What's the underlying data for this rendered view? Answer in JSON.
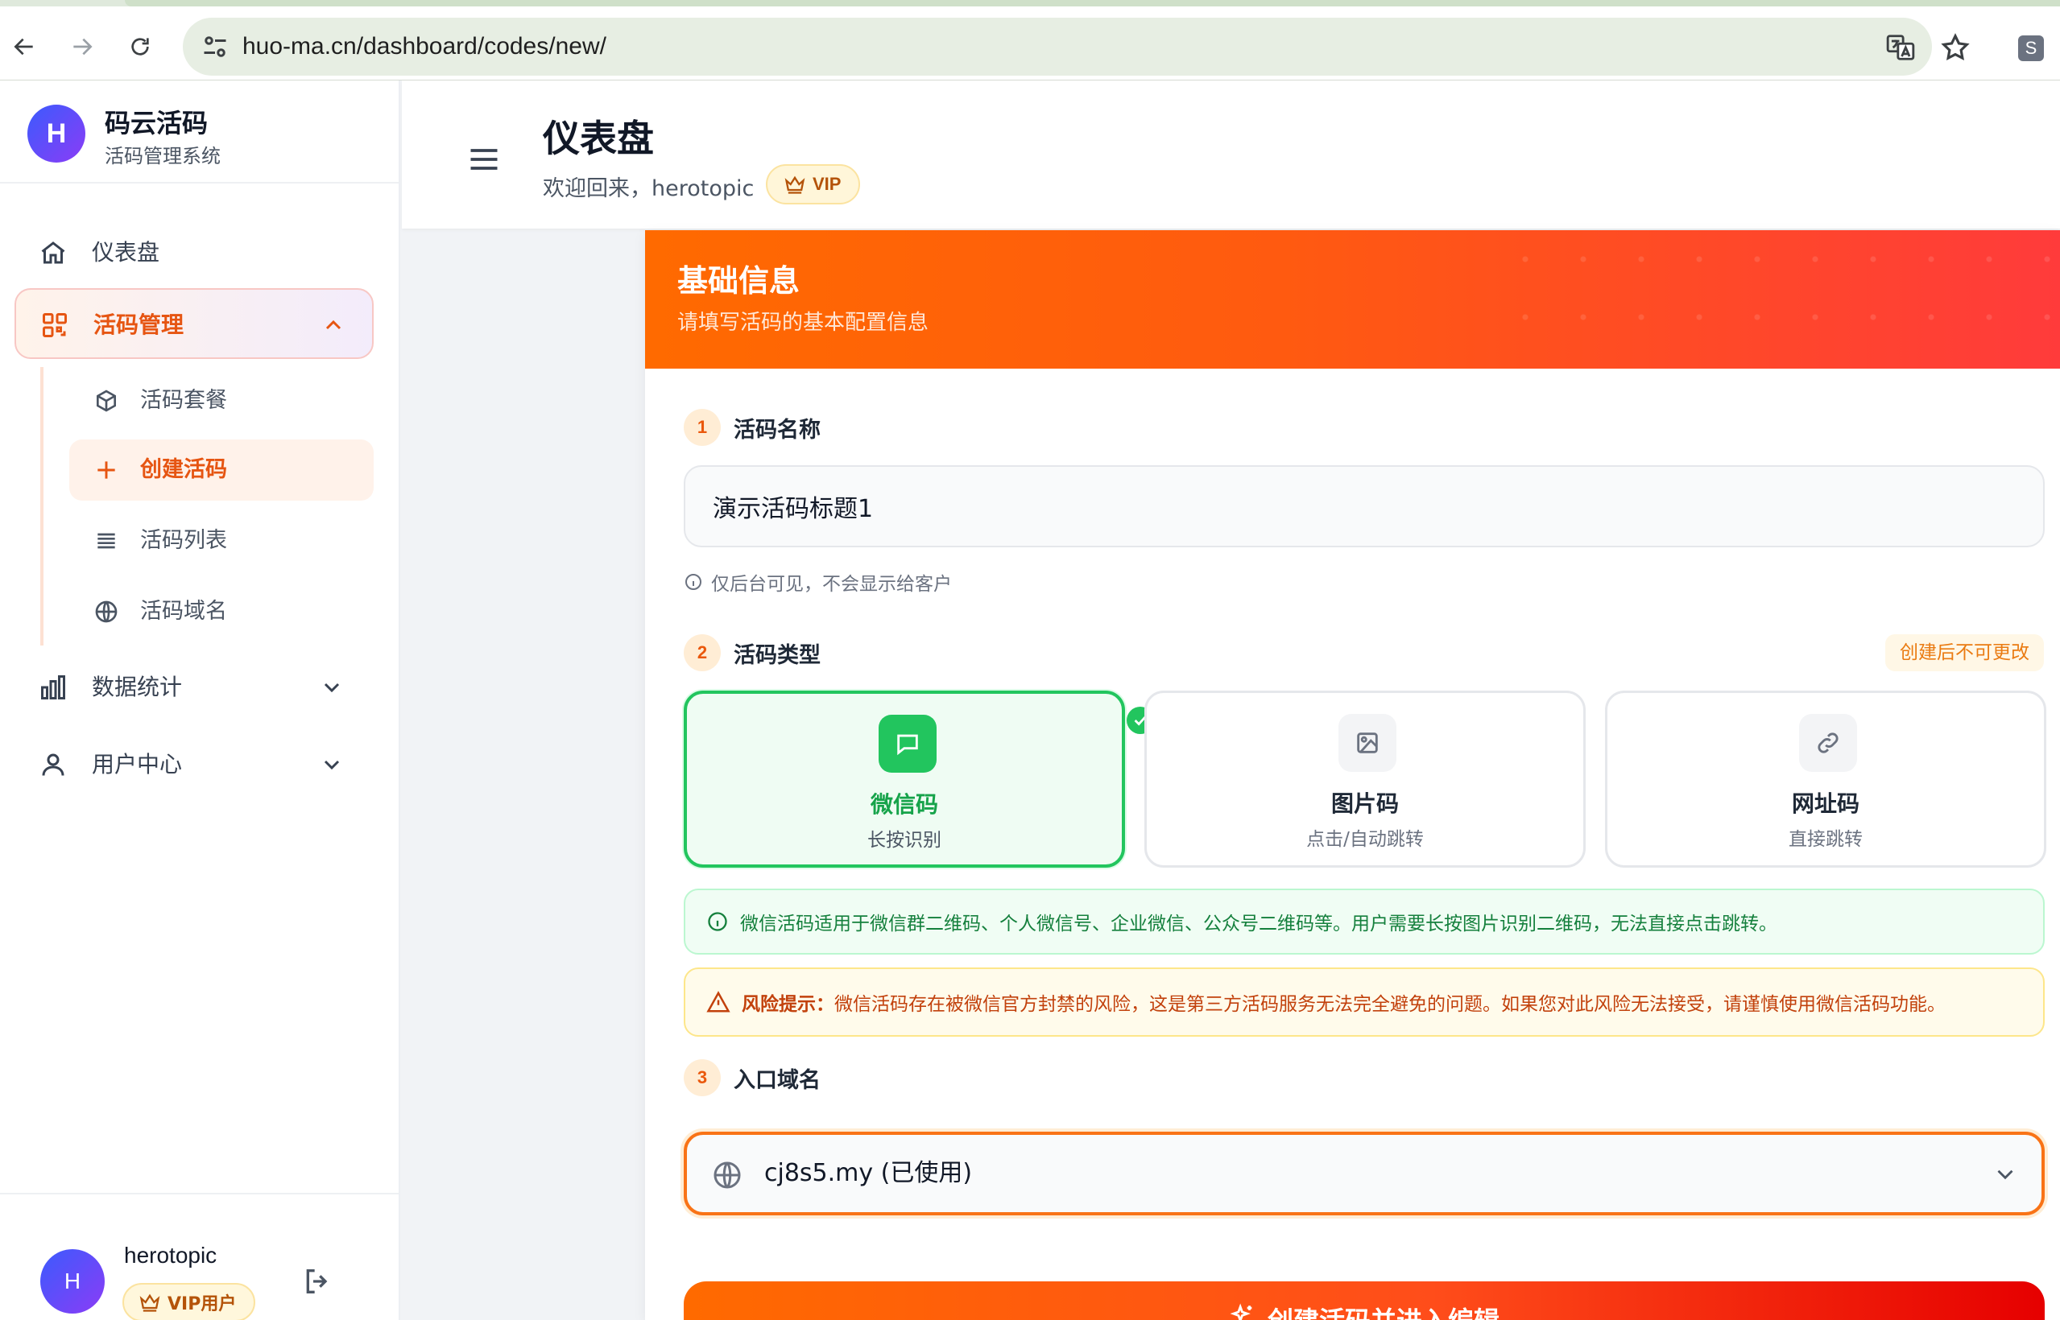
{
  "browser": {
    "url": "huo-ma.cn/dashboard/codes/new/",
    "profile_initial": "S"
  },
  "sidebar": {
    "brand": {
      "logo_letter": "H",
      "name": "码云活码",
      "subtitle": "活码管理系统"
    },
    "items": [
      {
        "label": "仪表盘",
        "icon": "home-icon"
      },
      {
        "label": "活码管理",
        "icon": "qrcode-icon",
        "expanded": true
      },
      {
        "label": "数据统计",
        "icon": "bar-chart-icon"
      },
      {
        "label": "用户中心",
        "icon": "user-icon"
      }
    ],
    "subitems": [
      {
        "label": "活码套餐",
        "icon": "cube-icon"
      },
      {
        "label": "创建活码",
        "icon": "plus-icon",
        "active": true
      },
      {
        "label": "活码列表",
        "icon": "list-icon"
      },
      {
        "label": "活码域名",
        "icon": "globe-icon"
      }
    ],
    "user": {
      "avatar_letter": "H",
      "name": "herotopic",
      "badge": "VIP用户"
    }
  },
  "header": {
    "title": "仪表盘",
    "welcome": "欢迎回来，herotopic",
    "vip_label": "VIP"
  },
  "form": {
    "title": "基础信息",
    "subtitle": "请填写活码的基本配置信息",
    "step1": {
      "num": "1",
      "label": "活码名称"
    },
    "name_value": "演示活码标题1",
    "name_hint": "仅后台可见，不会显示给客户",
    "step2": {
      "num": "2",
      "label": "活码类型"
    },
    "type_lock_note": "创建后不可更改",
    "types": [
      {
        "name": "微信码",
        "desc": "长按识别",
        "icon": "chat-icon",
        "selected": true
      },
      {
        "name": "图片码",
        "desc": "点击/自动跳转",
        "icon": "image-icon",
        "selected": false
      },
      {
        "name": "网址码",
        "desc": "直接跳转",
        "icon": "link-icon",
        "selected": false
      }
    ],
    "info_text": "微信活码适用于微信群二维码、个人微信号、企业微信、公众号二维码等。用户需要长按图片识别二维码，无法直接点击跳转。",
    "warning_label": "风险提示：",
    "warning_text": "微信活码存在被微信官方封禁的风险，这是第三方活码服务无法完全避免的问题。如果您对此风险无法接受，请谨慎使用微信活码功能。",
    "step3": {
      "num": "3",
      "label": "入口域名"
    },
    "domain_value": "cj8s5.my (已使用)",
    "submit_label": "创建活码并进入编辑"
  },
  "colors": {
    "accent": "#ff6a00",
    "accent_end": "#ff3b3b",
    "success": "#22c55e",
    "warning": "#c2410c",
    "brand_gradient_start": "#3b5bfd",
    "brand_gradient_end": "#8b3cf6"
  }
}
